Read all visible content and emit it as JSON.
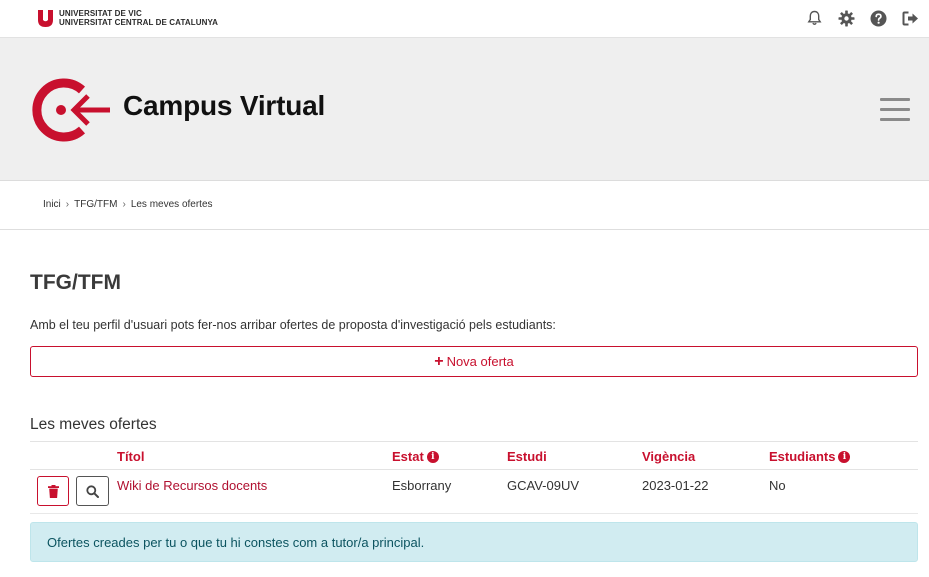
{
  "university": {
    "line1": "UNIVERSITAT DE VIC",
    "line2": "UNIVERSITAT CENTRAL DE CATALUNYA"
  },
  "topbar": {
    "icons": [
      "bell-icon",
      "gear-icon",
      "help-icon",
      "logout-icon"
    ]
  },
  "header": {
    "title": "Campus Virtual"
  },
  "breadcrumb": {
    "items": [
      "Inici",
      "TFG/TFM",
      "Les meves ofertes"
    ]
  },
  "page": {
    "title": "TFG/TFM",
    "intro": "Amb el teu perfil d'usuari pots fer-nos arribar ofertes de proposta d'investigació pels estudiants:",
    "new_offer_label": "Nova oferta",
    "section_title": "Les meves ofertes"
  },
  "table": {
    "headers": {
      "title": "Títol",
      "status": "Estat",
      "study": "Estudi",
      "validity": "Vigència",
      "students": "Estudiants"
    },
    "rows": [
      {
        "title": "Wiki de Recursos docents",
        "status": "Esborrany",
        "study": "GCAV-09UV",
        "validity": "2023-01-22",
        "students": "No"
      }
    ]
  },
  "alert": {
    "text": "Ofertes creades per tu o que tu hi constes com a tutor/a principal."
  },
  "colors": {
    "brand_red": "#c8102e",
    "header_bg": "#efefef",
    "alert_bg": "#d1ecf1",
    "alert_text": "#0c5460"
  }
}
